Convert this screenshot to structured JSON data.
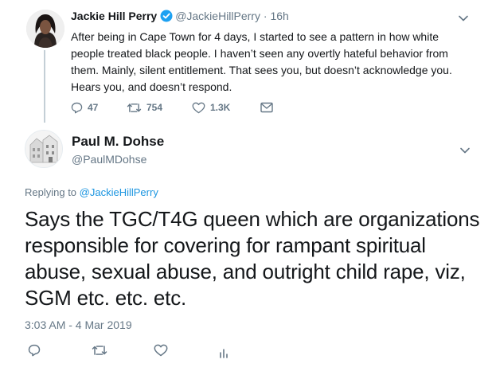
{
  "parent_tweet": {
    "author_name": "Jackie Hill Perry",
    "handle": "@JackieHillPerry",
    "separator": "·",
    "time": "16h",
    "text": "After being in Cape Town for 4 days, I started to see a pattern in how white people treated black people. I haven’t seen any overtly hateful behavior from them. Mainly, silent entitlement. That sees you, but doesn’t acknowledge you. Hears you, and doesn’t respond.",
    "replies": "47",
    "retweets": "754",
    "likes": "1.3K",
    "icons": {
      "reply": "reply-icon",
      "retweet": "retweet-icon",
      "like": "heart-icon",
      "message": "envelope-icon",
      "verified": "verified-badge-icon",
      "more": "chevron-down-icon"
    }
  },
  "main_tweet": {
    "author_name": "Paul M. Dohse",
    "handle": "@PaulMDohse",
    "replying_prefix": "Replying to ",
    "replying_to": "@JackieHillPerry",
    "text": "Says the TGC/T4G queen which are organizations responsible for covering for rampant spiritual abuse, sexual abuse, and outright child rape, viz, SGM etc. etc. etc.",
    "timestamp": "3:03 AM - 4 Mar 2019",
    "icons": {
      "reply": "reply-icon",
      "retweet": "retweet-icon",
      "like": "heart-icon",
      "analytics": "bar-chart-icon",
      "more": "chevron-down-icon"
    }
  },
  "colors": {
    "text": "#14171a",
    "secondary": "#657786",
    "link": "#1b95e0",
    "verified": "#1da1f2",
    "thread_line": "#c4cfd6"
  }
}
